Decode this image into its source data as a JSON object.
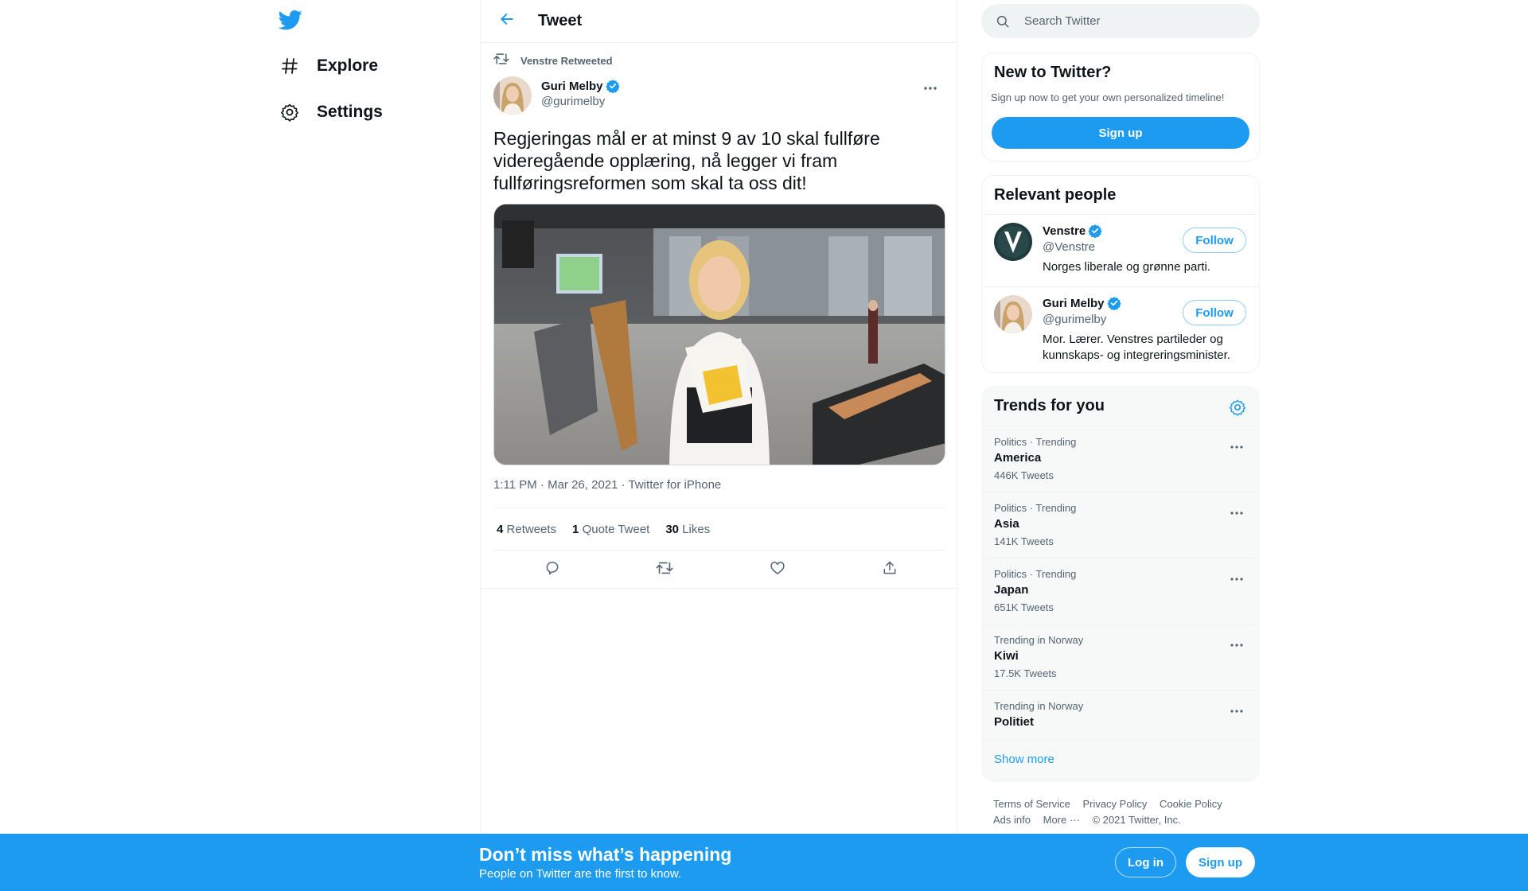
{
  "nav": {
    "logo": "twitter-bird-icon",
    "items": [
      {
        "label": "Explore",
        "icon": "hashtag-icon"
      },
      {
        "label": "Settings",
        "icon": "gear-icon"
      }
    ]
  },
  "main": {
    "title": "Tweet",
    "retweet_context": "Venstre Retweeted",
    "author": {
      "name": "Guri Melby",
      "handle": "@gurimelby",
      "verified": true
    },
    "text": "Regjeringas mål er at minst 9 av 10 skal fullføre videregående opplæring, nå legger vi fram fullføringsreformen som skal ta oss dit!",
    "timestamp": "1:11 PM · Mar 26, 2021 · ",
    "source": "Twitter for iPhone",
    "stats": {
      "retweets": {
        "count": "4",
        "label": "Retweets"
      },
      "quotes": {
        "count": "1",
        "label": "Quote Tweet"
      },
      "likes": {
        "count": "30",
        "label": "Likes"
      }
    },
    "actions": [
      "reply-icon",
      "retweet-icon",
      "like-icon",
      "share-icon"
    ]
  },
  "sidebar": {
    "search_placeholder": "Search Twitter",
    "new_to_twitter": {
      "title": "New to Twitter?",
      "subtitle": "Sign up now to get your own personalized timeline!",
      "button": "Sign up"
    },
    "relevant_people": {
      "title": "Relevant people",
      "people": [
        {
          "name": "Venstre",
          "handle": "@Venstre",
          "bio": "Norges liberale og grønne parti.",
          "button": "Follow"
        },
        {
          "name": "Guri Melby",
          "handle": "@gurimelby",
          "bio": "Mor. Lærer. Venstres partileder og kunnskaps- og integreringsminister.",
          "button": "Follow"
        }
      ]
    },
    "trends": {
      "title": "Trends for you",
      "items": [
        {
          "context": "Politics · Trending",
          "name": "America",
          "count": "446K Tweets"
        },
        {
          "context": "Politics · Trending",
          "name": "Asia",
          "count": "141K Tweets"
        },
        {
          "context": "Politics · Trending",
          "name": "Japan",
          "count": "651K Tweets"
        },
        {
          "context": "Trending in Norway",
          "name": "Kiwi",
          "count": "17.5K Tweets"
        },
        {
          "context": "Trending in Norway",
          "name": "Politiet",
          "count": ""
        }
      ],
      "show_more": "Show more"
    },
    "footer": {
      "links": [
        "Terms of Service",
        "Privacy Policy",
        "Cookie Policy",
        "Ads info",
        "More ···",
        "© 2021 Twitter, Inc."
      ]
    }
  },
  "bottom_bar": {
    "title": "Don’t miss what’s happening",
    "subtitle": "People on Twitter are the first to know.",
    "login": "Log in",
    "signup": "Sign up"
  },
  "colors": {
    "accent": "#1d9bf0",
    "text": "#0f1419",
    "secondary": "#536471"
  }
}
